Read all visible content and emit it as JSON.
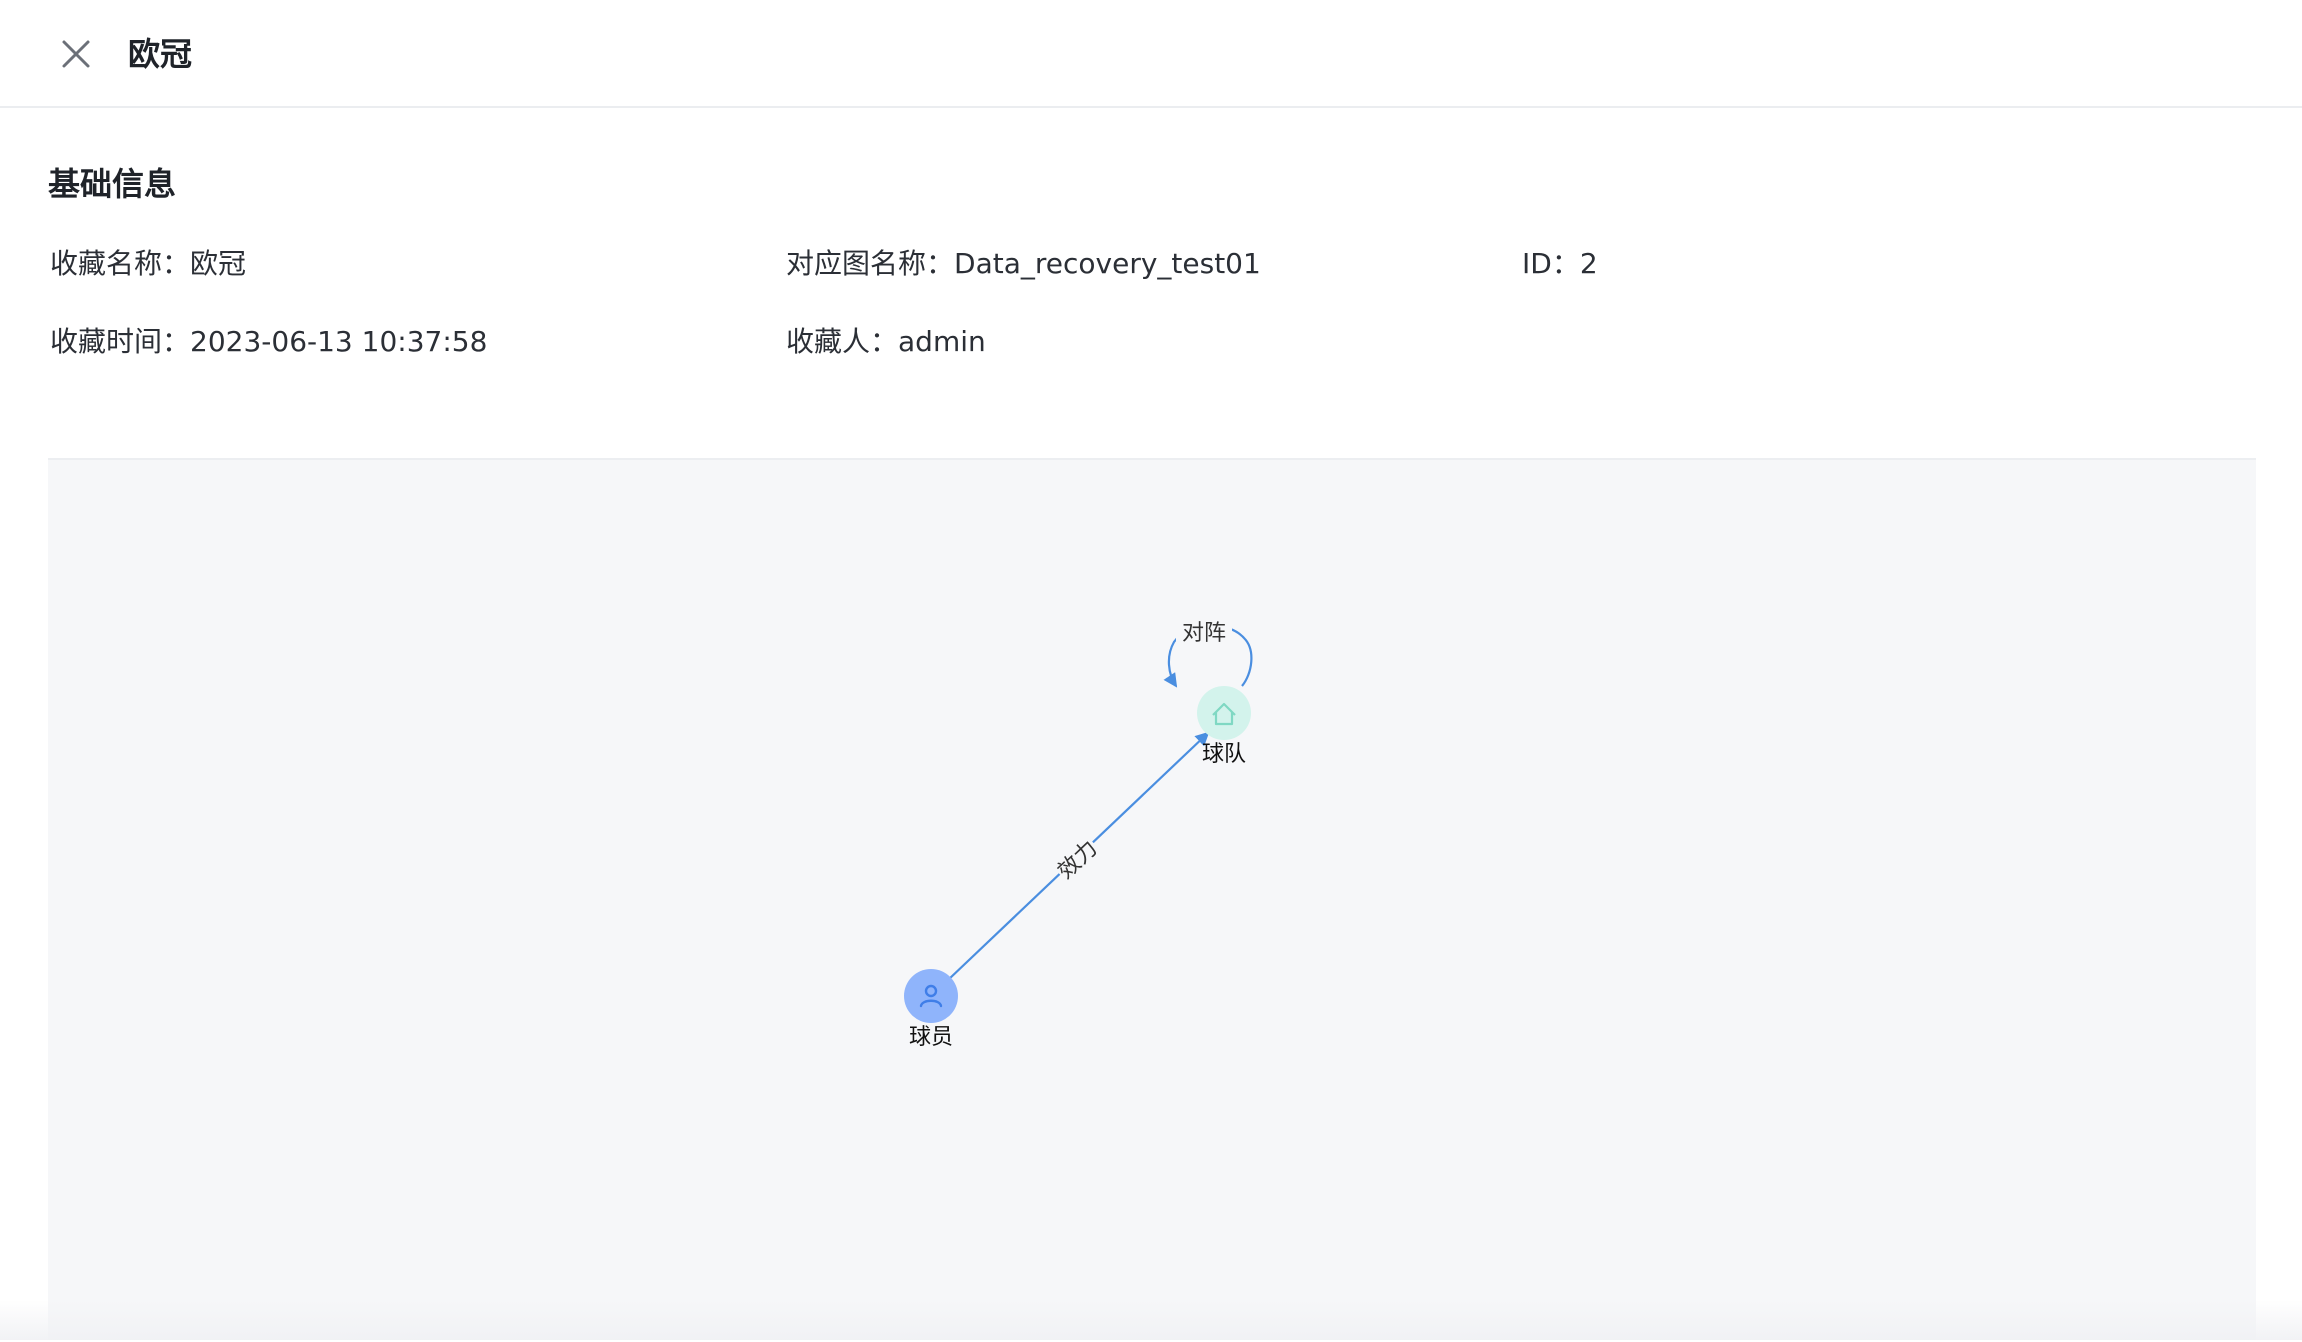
{
  "header": {
    "title": "欧冠",
    "close_icon": "close-icon"
  },
  "basic_info": {
    "section_title": "基础信息",
    "favorite_name_label": "收藏名称：",
    "favorite_name_value": "欧冠",
    "graph_name_label": "对应图名称：",
    "graph_name_value": "Data_recovery_test01",
    "id_label": "ID：",
    "id_value": "2",
    "favorite_time_label": "收藏时间：",
    "favorite_time_value": "2023-06-13 10:37:58",
    "favoriter_label": "收藏人：",
    "favoriter_value": "admin"
  },
  "graph": {
    "nodes": [
      {
        "id": "player",
        "label": "球员",
        "icon": "person-icon",
        "color": "#8fb4fb",
        "icon_color": "#3f7ee8"
      },
      {
        "id": "team",
        "label": "球队",
        "icon": "home-icon",
        "color": "#d3f3ec",
        "icon_color": "#7fd8c3"
      }
    ],
    "edges": [
      {
        "from": "player",
        "to": "team",
        "label": "效力",
        "color": "#4a8ee0"
      },
      {
        "from": "team",
        "to": "team",
        "label": "对阵",
        "color": "#4a8ee0"
      }
    ]
  }
}
